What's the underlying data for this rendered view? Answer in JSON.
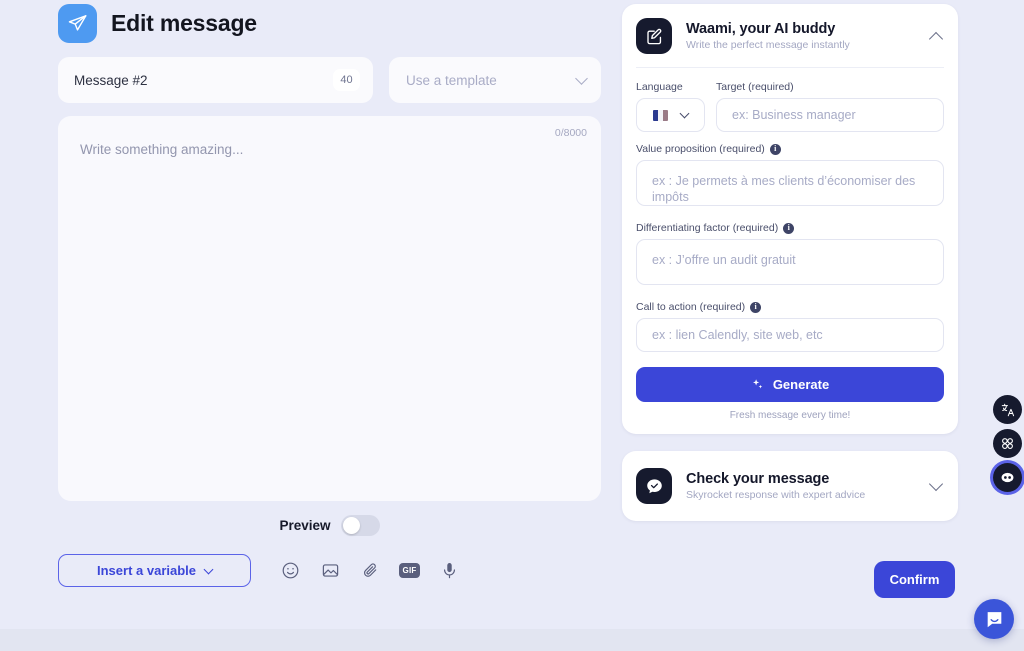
{
  "header": {
    "title": "Edit message",
    "icon": "send-plane-icon"
  },
  "message_meta": {
    "name": "Message #2",
    "count_badge": "40",
    "template_placeholder": "Use a template"
  },
  "editor": {
    "placeholder": "Write something amazing...",
    "char_count": "0/8000"
  },
  "preview": {
    "label": "Preview",
    "enabled": false
  },
  "toolbar": {
    "insert_variable_label": "Insert a variable",
    "icons": [
      {
        "name": "emoji-icon",
        "label": ""
      },
      {
        "name": "image-icon",
        "label": ""
      },
      {
        "name": "attachment-icon",
        "label": ""
      },
      {
        "name": "gif-icon",
        "label": "GIF"
      },
      {
        "name": "microphone-icon",
        "label": ""
      }
    ],
    "confirm_label": "Confirm"
  },
  "ai_panel": {
    "title": "Waami, your AI buddy",
    "subtitle": "Write the perfect message instantly",
    "icon": "edit-square-icon",
    "expanded": true,
    "fields": {
      "language_label": "Language",
      "language_flag": "flag-france",
      "target_label": "Target (required)",
      "target_placeholder": "ex: Business manager",
      "value_prop_label": "Value proposition (required)",
      "value_prop_placeholder": "ex : Je permets à mes clients d’économiser des impôts",
      "diff_label": "Differentiating factor (required)",
      "diff_placeholder": "ex : J’offre un audit gratuit",
      "cta_label": "Call to action (required)",
      "cta_placeholder": "ex : lien Calendly, site web, etc"
    },
    "generate_label": "Generate",
    "generate_note": "Fresh message every time!"
  },
  "check_panel": {
    "title": "Check your message",
    "subtitle": "Skyrocket response with expert advice",
    "icon": "chat-check-icon",
    "expanded": false
  },
  "rail": [
    {
      "name": "translate-icon"
    },
    {
      "name": "apps-grid-icon"
    },
    {
      "name": "assistant-avatar-icon"
    }
  ],
  "intercom": {
    "name": "intercom-launcher"
  },
  "colors": {
    "accent": "#3b46d8",
    "send_badge": "#4e9af1",
    "dark": "#161a2e",
    "background": "#e9ebf8"
  }
}
